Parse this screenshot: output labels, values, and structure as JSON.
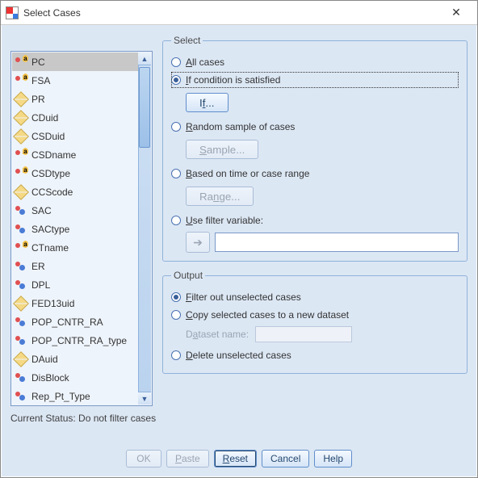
{
  "window": {
    "title": "Select Cases"
  },
  "variables": [
    {
      "name": "PC",
      "icon": "nominal-a",
      "selected": true
    },
    {
      "name": "FSA",
      "icon": "nominal-a"
    },
    {
      "name": "PR",
      "icon": "scale"
    },
    {
      "name": "CDuid",
      "icon": "scale"
    },
    {
      "name": "CSDuid",
      "icon": "scale"
    },
    {
      "name": "CSDname",
      "icon": "nominal-a"
    },
    {
      "name": "CSDtype",
      "icon": "nominal-a"
    },
    {
      "name": "CCScode",
      "icon": "scale"
    },
    {
      "name": "SAC",
      "icon": "nominal"
    },
    {
      "name": "SACtype",
      "icon": "nominal"
    },
    {
      "name": "CTname",
      "icon": "nominal-a"
    },
    {
      "name": "ER",
      "icon": "nominal"
    },
    {
      "name": "DPL",
      "icon": "nominal"
    },
    {
      "name": "FED13uid",
      "icon": "scale"
    },
    {
      "name": "POP_CNTR_RA",
      "icon": "nominal"
    },
    {
      "name": "POP_CNTR_RA_type",
      "icon": "nominal"
    },
    {
      "name": "DAuid",
      "icon": "scale"
    },
    {
      "name": "DisBlock",
      "icon": "nominal"
    },
    {
      "name": "Rep_Pt_Type",
      "icon": "nominal"
    }
  ],
  "select": {
    "legend": "Select",
    "opt_all": "All cases",
    "opt_all_u": "A",
    "opt_if": "If condition is satisfied",
    "opt_if_u": "I",
    "btn_if": "If...",
    "btn_if_u": "f",
    "opt_random": "Random sample of cases",
    "opt_random_u": "R",
    "btn_sample": "Sample...",
    "btn_sample_u": "S",
    "opt_range": "Based on time or case range",
    "opt_range_u": "B",
    "btn_range": "Range...",
    "btn_range_u": "n",
    "opt_filter": "Use filter variable:",
    "opt_filter_u": "U",
    "selected": "if"
  },
  "output": {
    "legend": "Output",
    "opt_filterout": "Filter out unselected cases",
    "opt_filterout_u": "F",
    "opt_copy": "Copy selected cases to a new dataset",
    "opt_copy_u": "C",
    "dataset_label": "Dataset name:",
    "dataset_label_u": "a",
    "opt_delete": "Delete unselected cases",
    "opt_delete_u": "D",
    "selected": "filterout"
  },
  "status": "Current Status: Do not filter cases",
  "buttons": {
    "ok": "OK",
    "paste": "Paste",
    "paste_u": "P",
    "reset": "Reset",
    "reset_u": "R",
    "cancel": "Cancel",
    "help": "Help"
  },
  "close_glyph": "✕"
}
